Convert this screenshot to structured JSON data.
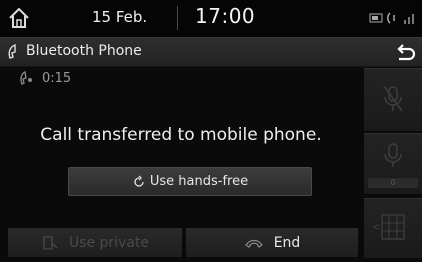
{
  "status_bar": {
    "date": "15 Feb.",
    "time": "17:00",
    "icons": [
      "home-icon",
      "battery-icon",
      "bluetooth-phone-icon",
      "signal-icon"
    ]
  },
  "title_bar": {
    "title": "Bluetooth Phone",
    "icons": [
      "phone-handset-icon",
      "back-arrow-icon"
    ]
  },
  "call": {
    "duration": "0:15",
    "message": "Call transferred to mobile phone."
  },
  "buttons": {
    "handsfree_label": "Use hands-free",
    "use_private_label": "Use private",
    "end_label": "End"
  },
  "side_panel": {
    "volume_label": "0",
    "icons": [
      "microphone-mute-icon",
      "microphone-volume-icon",
      "keypad-icon"
    ]
  },
  "colors": {
    "background": "#0a0a0a",
    "title_bar": "#2a2a2a",
    "text": "#e8e8e8",
    "disabled_text": "#4a4a4a"
  }
}
